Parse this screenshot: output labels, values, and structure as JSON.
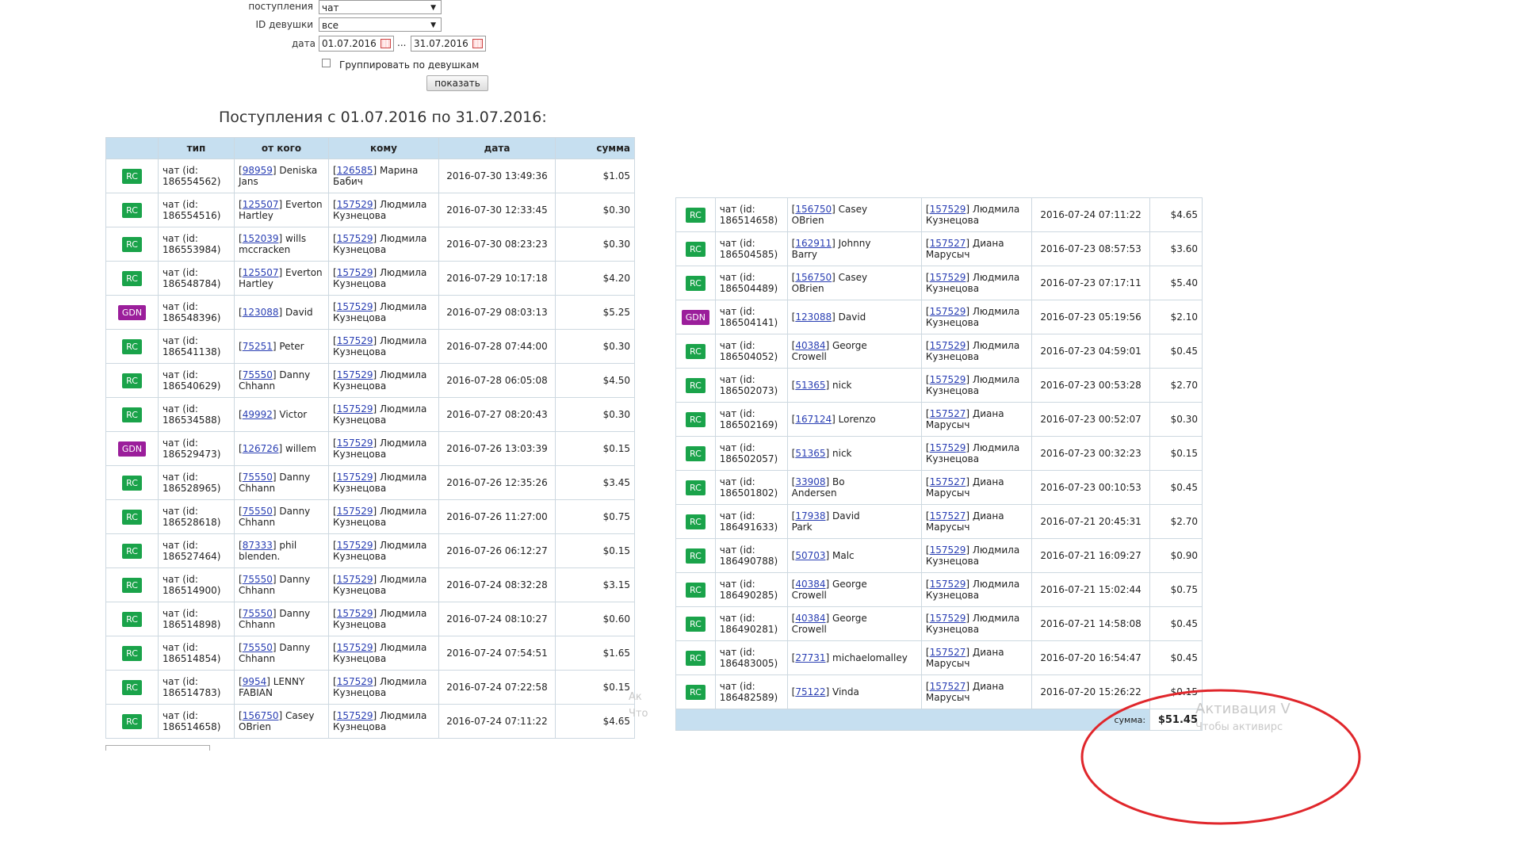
{
  "filters": {
    "source_label": "поступления",
    "source_value": "чат",
    "girl_label": "ID девушки",
    "girl_value": "все",
    "date_label": "дата",
    "date_from": "01.07.2016",
    "date_sep": "...",
    "date_to": "31.07.2016",
    "group_label": "Группировать по девушкам",
    "show_button": "показать"
  },
  "heading": "Поступления с 01.07.2016 по 31.07.2016:",
  "columns": [
    "тип",
    "от кого",
    "кому",
    "дата",
    "сумма"
  ],
  "left_rows": [
    {
      "badge": "RC",
      "t1": "чат (id:",
      "t2": "186554562)",
      "fid": "98959",
      "f1": "Deniska",
      "f2": "Jans",
      "tid": "126585",
      "to1": "Марина",
      "to2": "Бабич",
      "date": "2016-07-30 13:49:36",
      "sum": "$1.05"
    },
    {
      "badge": "RC",
      "t1": "чат (id:",
      "t2": "186554516)",
      "fid": "125507",
      "f1": "Everton",
      "f2": "Hartley",
      "tid": "157529",
      "to1": "Людмила",
      "to2": "Кузнецова",
      "date": "2016-07-30 12:33:45",
      "sum": "$0.30"
    },
    {
      "badge": "RC",
      "t1": "чат (id:",
      "t2": "186553984)",
      "fid": "152039",
      "f1": "wills",
      "f2": "mccracken",
      "tid": "157529",
      "to1": "Людмила",
      "to2": "Кузнецова",
      "date": "2016-07-30 08:23:23",
      "sum": "$0.30"
    },
    {
      "badge": "RC",
      "t1": "чат (id:",
      "t2": "186548784)",
      "fid": "125507",
      "f1": "Everton",
      "f2": "Hartley",
      "tid": "157529",
      "to1": "Людмила",
      "to2": "Кузнецова",
      "date": "2016-07-29 10:17:18",
      "sum": "$4.20"
    },
    {
      "badge": "GDN",
      "t1": "чат (id:",
      "t2": "186548396)",
      "fid": "123088",
      "f1": "David",
      "f2": "",
      "tid": "157529",
      "to1": "Людмила",
      "to2": "Кузнецова",
      "date": "2016-07-29 08:03:13",
      "sum": "$5.25"
    },
    {
      "badge": "RC",
      "t1": "чат (id:",
      "t2": "186541138)",
      "fid": "75251",
      "f1": "Peter",
      "f2": "",
      "tid": "157529",
      "to1": "Людмила",
      "to2": "Кузнецова",
      "date": "2016-07-28 07:44:00",
      "sum": "$0.30"
    },
    {
      "badge": "RC",
      "t1": "чат (id:",
      "t2": "186540629)",
      "fid": "75550",
      "f1": "Danny",
      "f2": "Chhann",
      "tid": "157529",
      "to1": "Людмила",
      "to2": "Кузнецова",
      "date": "2016-07-28 06:05:08",
      "sum": "$4.50"
    },
    {
      "badge": "RC",
      "t1": "чат (id:",
      "t2": "186534588)",
      "fid": "49992",
      "f1": "Victor",
      "f2": "",
      "tid": "157529",
      "to1": "Людмила",
      "to2": "Кузнецова",
      "date": "2016-07-27 08:20:43",
      "sum": "$0.30"
    },
    {
      "badge": "GDN",
      "t1": "чат (id:",
      "t2": "186529473)",
      "fid": "126726",
      "f1": "willem",
      "f2": "",
      "tid": "157529",
      "to1": "Людмила",
      "to2": "Кузнецова",
      "date": "2016-07-26 13:03:39",
      "sum": "$0.15"
    },
    {
      "badge": "RC",
      "t1": "чат (id:",
      "t2": "186528965)",
      "fid": "75550",
      "f1": "Danny",
      "f2": "Chhann",
      "tid": "157529",
      "to1": "Людмила",
      "to2": "Кузнецова",
      "date": "2016-07-26 12:35:26",
      "sum": "$3.45"
    },
    {
      "badge": "RC",
      "t1": "чат (id:",
      "t2": "186528618)",
      "fid": "75550",
      "f1": "Danny",
      "f2": "Chhann",
      "tid": "157529",
      "to1": "Людмила",
      "to2": "Кузнецова",
      "date": "2016-07-26 11:27:00",
      "sum": "$0.75"
    },
    {
      "badge": "RC",
      "t1": "чат (id:",
      "t2": "186527464)",
      "fid": "87333",
      "f1": "phil",
      "f2": "blenden.",
      "tid": "157529",
      "to1": "Людмила",
      "to2": "Кузнецова",
      "date": "2016-07-26 06:12:27",
      "sum": "$0.15"
    },
    {
      "badge": "RC",
      "t1": "чат (id:",
      "t2": "186514900)",
      "fid": "75550",
      "f1": "Danny",
      "f2": "Chhann",
      "tid": "157529",
      "to1": "Людмила",
      "to2": "Кузнецова",
      "date": "2016-07-24 08:32:28",
      "sum": "$3.15"
    },
    {
      "badge": "RC",
      "t1": "чат (id:",
      "t2": "186514898)",
      "fid": "75550",
      "f1": "Danny",
      "f2": "Chhann",
      "tid": "157529",
      "to1": "Людмила",
      "to2": "Кузнецова",
      "date": "2016-07-24 08:10:27",
      "sum": "$0.60"
    },
    {
      "badge": "RC",
      "t1": "чат (id:",
      "t2": "186514854)",
      "fid": "75550",
      "f1": "Danny",
      "f2": "Chhann",
      "tid": "157529",
      "to1": "Людмила",
      "to2": "Кузнецова",
      "date": "2016-07-24 07:54:51",
      "sum": "$1.65"
    },
    {
      "badge": "RC",
      "t1": "чат (id:",
      "t2": "186514783)",
      "fid": "9954",
      "f1": "LENNY",
      "f2": "FABIAN",
      "tid": "157529",
      "to1": "Людмила",
      "to2": "Кузнецова",
      "date": "2016-07-24 07:22:58",
      "sum": "$0.15"
    },
    {
      "badge": "RC",
      "t1": "чат (id:",
      "t2": "186514658)",
      "fid": "156750",
      "f1": "Casey",
      "f2": "OBrien",
      "tid": "157529",
      "to1": "Людмила",
      "to2": "Кузнецова",
      "date": "2016-07-24 07:11:22",
      "sum": "$4.65"
    }
  ],
  "right_rows": [
    {
      "badge": "RC",
      "t1": "чат (id:",
      "t2": "186514658)",
      "fid": "156750",
      "f1": "Casey",
      "f2": "OBrien",
      "tid": "157529",
      "to1": "Людмила",
      "to2": "Кузнецова",
      "date": "2016-07-24 07:11:22",
      "sum": "$4.65"
    },
    {
      "badge": "RC",
      "t1": "чат (id:",
      "t2": "186504585)",
      "fid": "162911",
      "f1": "Johnny",
      "f2": "Barry",
      "tid": "157527",
      "to1": "Диана",
      "to2": "Марусыч",
      "date": "2016-07-23 08:57:53",
      "sum": "$3.60"
    },
    {
      "badge": "RC",
      "t1": "чат (id:",
      "t2": "186504489)",
      "fid": "156750",
      "f1": "Casey",
      "f2": "OBrien",
      "tid": "157529",
      "to1": "Людмила",
      "to2": "Кузнецова",
      "date": "2016-07-23 07:17:11",
      "sum": "$5.40"
    },
    {
      "badge": "GDN",
      "t1": "чат (id:",
      "t2": "186504141)",
      "fid": "123088",
      "f1": "David",
      "f2": "",
      "tid": "157529",
      "to1": "Людмила",
      "to2": "Кузнецова",
      "date": "2016-07-23 05:19:56",
      "sum": "$2.10"
    },
    {
      "badge": "RC",
      "t1": "чат (id:",
      "t2": "186504052)",
      "fid": "40384",
      "f1": "George",
      "f2": "Crowell",
      "tid": "157529",
      "to1": "Людмила",
      "to2": "Кузнецова",
      "date": "2016-07-23 04:59:01",
      "sum": "$0.45"
    },
    {
      "badge": "RC",
      "t1": "чат (id:",
      "t2": "186502073)",
      "fid": "51365",
      "f1": "nick",
      "f2": "",
      "tid": "157529",
      "to1": "Людмила",
      "to2": "Кузнецова",
      "date": "2016-07-23 00:53:28",
      "sum": "$2.70"
    },
    {
      "badge": "RC",
      "t1": "чат (id:",
      "t2": "186502169)",
      "fid": "167124",
      "f1": "Lorenzo",
      "f2": "",
      "tid": "157527",
      "to1": "Диана",
      "to2": "Марусыч",
      "date": "2016-07-23 00:52:07",
      "sum": "$0.30"
    },
    {
      "badge": "RC",
      "t1": "чат (id:",
      "t2": "186502057)",
      "fid": "51365",
      "f1": "nick",
      "f2": "",
      "tid": "157529",
      "to1": "Людмила",
      "to2": "Кузнецова",
      "date": "2016-07-23 00:32:23",
      "sum": "$0.15"
    },
    {
      "badge": "RC",
      "t1": "чат (id:",
      "t2": "186501802)",
      "fid": "33908",
      "f1": "Bo",
      "f2": "Andersen",
      "tid": "157527",
      "to1": "Диана",
      "to2": "Марусыч",
      "date": "2016-07-23 00:10:53",
      "sum": "$0.45"
    },
    {
      "badge": "RC",
      "t1": "чат (id:",
      "t2": "186491633)",
      "fid": "17938",
      "f1": "David",
      "f2": "Park",
      "tid": "157527",
      "to1": "Диана",
      "to2": "Марусыч",
      "date": "2016-07-21 20:45:31",
      "sum": "$2.70"
    },
    {
      "badge": "RC",
      "t1": "чат (id:",
      "t2": "186490788)",
      "fid": "50703",
      "f1": "Malc",
      "f2": "",
      "tid": "157529",
      "to1": "Людмила",
      "to2": "Кузнецова",
      "date": "2016-07-21 16:09:27",
      "sum": "$0.90"
    },
    {
      "badge": "RC",
      "t1": "чат (id:",
      "t2": "186490285)",
      "fid": "40384",
      "f1": "George",
      "f2": "Crowell",
      "tid": "157529",
      "to1": "Людмила",
      "to2": "Кузнецова",
      "date": "2016-07-21 15:02:44",
      "sum": "$0.75"
    },
    {
      "badge": "RC",
      "t1": "чат (id:",
      "t2": "186490281)",
      "fid": "40384",
      "f1": "George",
      "f2": "Crowell",
      "tid": "157529",
      "to1": "Людмила",
      "to2": "Кузнецова",
      "date": "2016-07-21 14:58:08",
      "sum": "$0.45"
    },
    {
      "badge": "RC",
      "t1": "чат (id:",
      "t2": "186483005)",
      "fid": "27731",
      "f1": "michaelomalley",
      "f2": "",
      "tid": "157527",
      "to1": "Диана",
      "to2": "Марусыч",
      "date": "2016-07-20 16:54:47",
      "sum": "$0.45"
    },
    {
      "badge": "RC",
      "t1": "чат (id:",
      "t2": "186482589)",
      "fid": "75122",
      "f1": "Vinda",
      "f2": "",
      "tid": "157527",
      "to1": "Диана",
      "to2": "Марусыч",
      "date": "2016-07-20 15:26:22",
      "sum": "$0.15"
    }
  ],
  "total": {
    "label": "сумма:",
    "value": "$51.45"
  },
  "watermark": {
    "line1": "Активация V",
    "line2": "Чтобы активирс",
    "left1": "Ак",
    "left2": "Что"
  },
  "colors": {
    "rc": "#1aa34a",
    "gdn": "#9b1e9b",
    "header": "#c6dff0",
    "annotation": "#e0262b"
  }
}
